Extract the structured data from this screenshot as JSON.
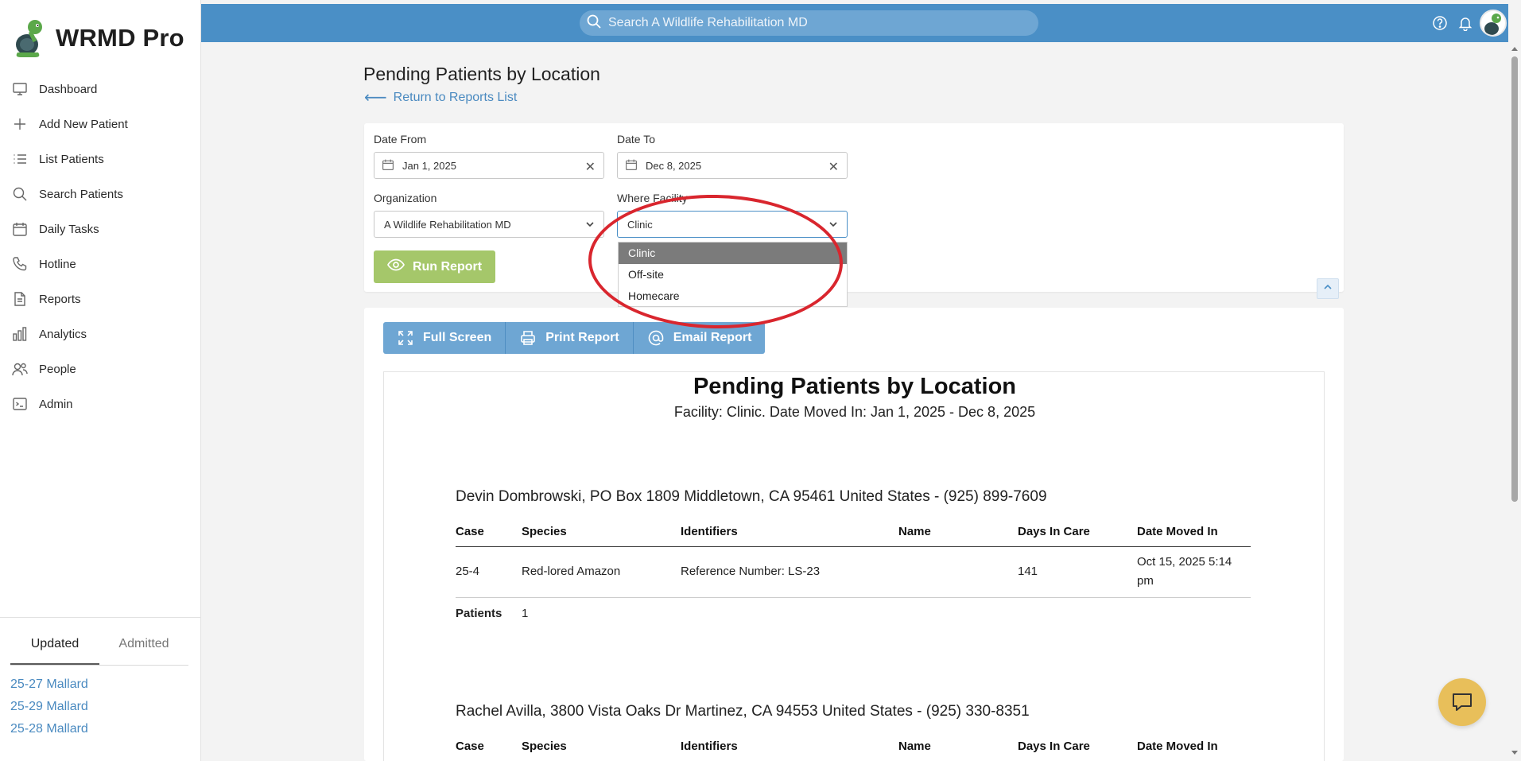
{
  "app": {
    "name": "WRMD Pro"
  },
  "search": {
    "placeholder": "Search A Wildlife Rehabilitation MD"
  },
  "sidebar": {
    "items": [
      {
        "label": "Dashboard",
        "icon": "monitor-icon"
      },
      {
        "label": "Add New Patient",
        "icon": "plus-icon"
      },
      {
        "label": "List Patients",
        "icon": "list-icon"
      },
      {
        "label": "Search Patients",
        "icon": "search-icon"
      },
      {
        "label": "Daily Tasks",
        "icon": "calendar-icon"
      },
      {
        "label": "Hotline",
        "icon": "phone-icon"
      },
      {
        "label": "Reports",
        "icon": "document-icon"
      },
      {
        "label": "Analytics",
        "icon": "bar-chart-icon"
      },
      {
        "label": "People",
        "icon": "people-icon"
      },
      {
        "label": "Admin",
        "icon": "terminal-icon"
      }
    ],
    "recent": {
      "tabs": [
        "Updated",
        "Admitted"
      ],
      "active_tab": "Updated",
      "links": [
        "25-27 Mallard",
        "25-29 Mallard",
        "25-28 Mallard"
      ]
    }
  },
  "page": {
    "title": "Pending Patients by Location",
    "back_link": "Return to Reports List"
  },
  "filters": {
    "date_from": {
      "label": "Date From",
      "value": "Jan 1, 2025"
    },
    "date_to": {
      "label": "Date To",
      "value": "Dec 8, 2025"
    },
    "organization": {
      "label": "Organization",
      "value": "A Wildlife Rehabilitation MD"
    },
    "facility": {
      "label": "Where Facility",
      "value": "Clinic",
      "options": [
        "Clinic",
        "Off-site",
        "Homecare"
      ],
      "highlighted": "Clinic"
    },
    "run_button": "Run Report"
  },
  "toolbar": {
    "full_screen": "Full Screen",
    "print": "Print Report",
    "email": "Email Report"
  },
  "report": {
    "title": "Pending Patients by Location",
    "subtitle": "Facility: Clinic. Date Moved In: Jan 1, 2025 - Dec 8, 2025",
    "columns": [
      "Case",
      "Species",
      "Identifiers",
      "Name",
      "Days In Care",
      "Date Moved In"
    ],
    "groups": [
      {
        "header": "Devin Dombrowski, PO Box 1809 Middletown, CA 95461 United States - (925) 899-7609",
        "rows": [
          {
            "case": "25-4",
            "species": "Red-lored Amazon",
            "identifiers": "Reference Number: LS-23",
            "name": "",
            "days": "141",
            "date_line1": "Oct 15, 2025 5:14",
            "date_line2": "pm"
          }
        ],
        "patients_label": "Patients",
        "patients_count": "1"
      },
      {
        "header": "Rachel Avilla, 3800 Vista Oaks Dr Martinez, CA 94553 United States - (925) 330-8351",
        "rows": []
      }
    ]
  },
  "colors": {
    "topbar": "#4a8fc6",
    "run_button": "#a5c76a",
    "toolbar_button": "#6ea6d3",
    "annotation": "#d9262e",
    "help_fab": "#e8bf5a"
  }
}
